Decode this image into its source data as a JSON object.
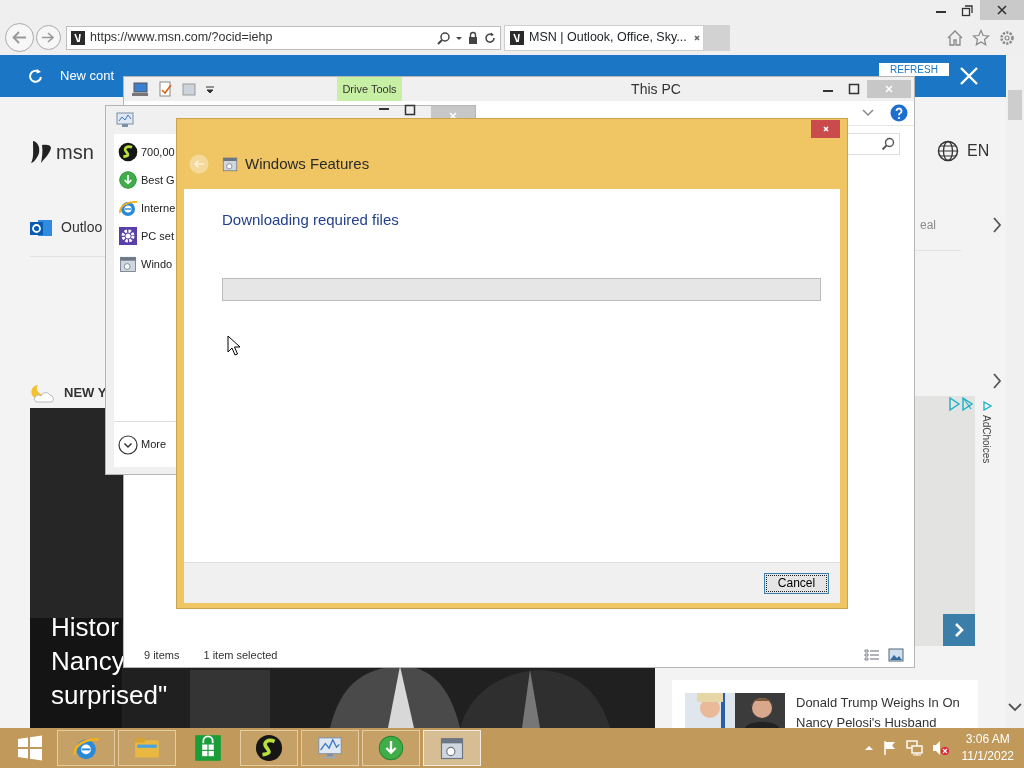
{
  "browser": {
    "address": "https://www.msn.com/?ocid=iehp",
    "tabs": [
      {
        "title": "MSN | Outlook, Office, Sky...",
        "selected": true
      }
    ]
  },
  "notification": {
    "text": "New cont",
    "button": "REFRESH"
  },
  "msn": {
    "logo": "msn",
    "outlook_link": "Outloo",
    "weather": "NEW Y",
    "headline": [
      "Histor",
      "Nancy",
      "surprised\""
    ],
    "faded_text": "eal",
    "language": "EN",
    "ad_label": "AdChoices",
    "story": {
      "title": "Donald Trump Weighs In On Nancy Pelosi's Husband"
    }
  },
  "explorer": {
    "title": "This PC",
    "context_tab": "Drive Tools",
    "status": [
      "9 items",
      "1 item selected"
    ]
  },
  "task_manager": {
    "apps": [
      {
        "kind": "s-app",
        "name": "700,00"
      },
      {
        "kind": "download",
        "name": "Best G"
      },
      {
        "kind": "ie",
        "name": "Interne"
      },
      {
        "kind": "settings",
        "name": "PC set"
      },
      {
        "kind": "features",
        "name": "Windo"
      }
    ],
    "more": "More"
  },
  "dialog": {
    "title": "Windows Features",
    "heading": "Downloading required files",
    "progress": {
      "level": 0
    },
    "button": "Cancel"
  },
  "taskbar": {
    "apps": [
      {
        "kind": "ie",
        "running": true,
        "selected": false
      },
      {
        "kind": "explorer",
        "running": true,
        "selected": false
      },
      {
        "kind": "store",
        "running": false,
        "selected": false
      },
      {
        "kind": "s-app",
        "running": true,
        "selected": false
      },
      {
        "kind": "taskmgr",
        "running": true,
        "selected": false
      },
      {
        "kind": "download",
        "running": true,
        "selected": false
      },
      {
        "kind": "features",
        "running": true,
        "selected": true
      }
    ],
    "time": "3:06 AM",
    "date": "11/1/2022"
  }
}
